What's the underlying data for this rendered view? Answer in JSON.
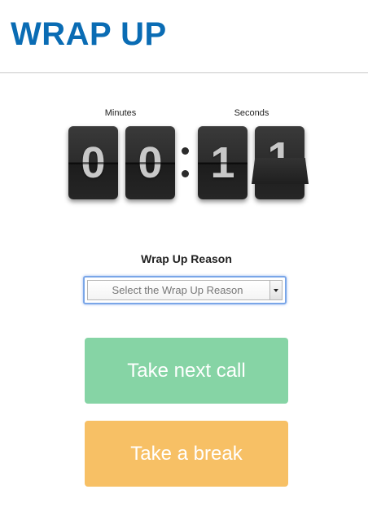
{
  "header": {
    "title": "WRAP UP"
  },
  "timer": {
    "minutes_label": "Minutes",
    "seconds_label": "Seconds",
    "digits": [
      "0",
      "0",
      "1",
      "1"
    ]
  },
  "wrap_up_reason": {
    "label": "Wrap Up Reason",
    "placeholder": "Select the Wrap Up Reason"
  },
  "actions": {
    "take_next_call": "Take next call",
    "take_a_break": "Take a break"
  },
  "colors": {
    "title": "#0a6cb4",
    "take_next_call_bg": "#86d4a5",
    "take_a_break_bg": "#f7c065",
    "select_focus_border": "#7aa6e8"
  },
  "icons": {
    "select_arrow": "chevron-down-icon"
  }
}
